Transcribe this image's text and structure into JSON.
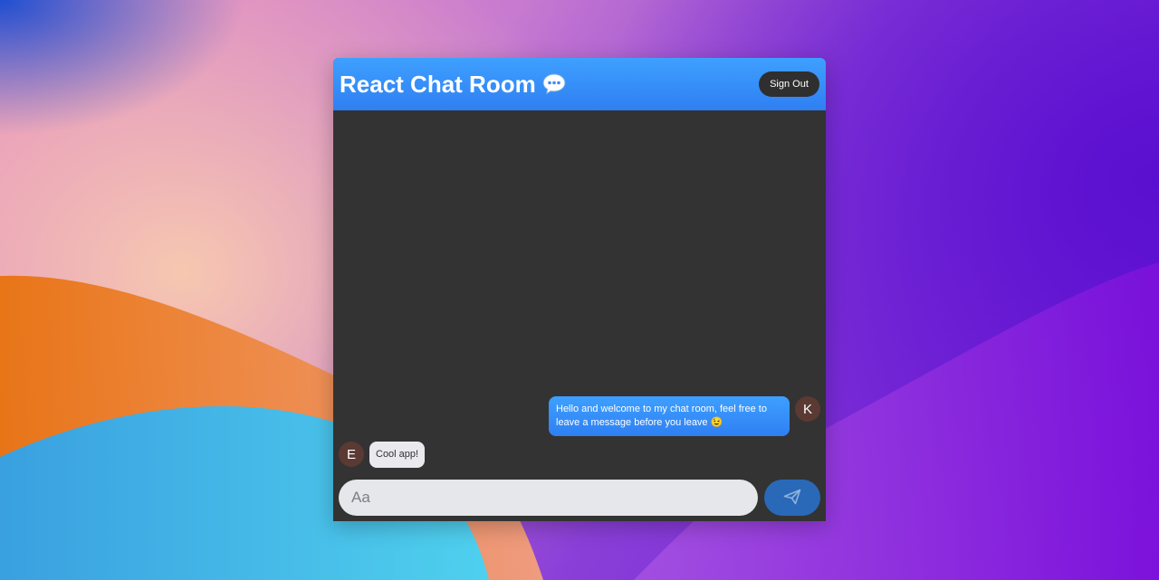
{
  "header": {
    "title": "React Chat Room",
    "title_icon": "speech-bubble-icon",
    "signout_label": "Sign Out"
  },
  "messages": [
    {
      "direction": "sent",
      "avatar_initial": "K",
      "text": "Hello and welcome to my chat room, feel free to leave a message before you leave 😉"
    },
    {
      "direction": "received",
      "avatar_initial": "E",
      "text": "Cool app!"
    }
  ],
  "composer": {
    "placeholder": "Aa",
    "send_icon": "paper-plane-icon"
  },
  "colors": {
    "header_accent": "#3ea0ff",
    "chat_background": "#333333",
    "send_button": "#2a69b8",
    "avatar": "#5b3a34"
  }
}
